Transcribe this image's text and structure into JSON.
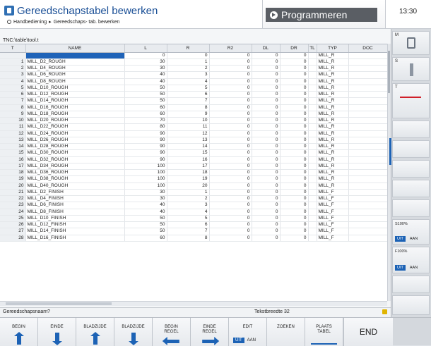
{
  "header": {
    "title": "Gereedschapstabel bewerken",
    "breadcrumb": [
      "Handbediening",
      "Gereedschaps- tab. bewerken"
    ],
    "mode": "Programmeren",
    "clock": "13:30"
  },
  "file_path": "TNC:\\table\\tool.t",
  "table": {
    "columns": [
      "T",
      "NAME",
      "L",
      "R",
      "R2",
      "DL",
      "DR",
      "TL",
      "TYP",
      "DOC"
    ],
    "rows": [
      [
        "",
        "",
        "0",
        "0",
        "0",
        "0",
        "0",
        "",
        "MILL_R",
        ""
      ],
      [
        "1",
        "MILL_D2_ROUGH",
        "30",
        "1",
        "0",
        "0",
        "0",
        "",
        "MILL_R",
        ""
      ],
      [
        "2",
        "MILL_D4_ROUGH",
        "30",
        "2",
        "0",
        "0",
        "0",
        "",
        "MILL_R",
        ""
      ],
      [
        "3",
        "MILL_D6_ROUGH",
        "40",
        "3",
        "0",
        "0",
        "0",
        "",
        "MILL_R",
        ""
      ],
      [
        "4",
        "MILL_D8_ROUGH",
        "40",
        "4",
        "0",
        "0",
        "0",
        "",
        "MILL_R",
        ""
      ],
      [
        "5",
        "MILL_D10_ROUGH",
        "50",
        "5",
        "0",
        "0",
        "0",
        "",
        "MILL_R",
        ""
      ],
      [
        "6",
        "MILL_D12_ROUGH",
        "50",
        "6",
        "0",
        "0",
        "0",
        "",
        "MILL_R",
        ""
      ],
      [
        "7",
        "MILL_D14_ROUGH",
        "50",
        "7",
        "0",
        "0",
        "0",
        "",
        "MILL_R",
        ""
      ],
      [
        "8",
        "MILL_D16_ROUGH",
        "60",
        "8",
        "0",
        "0",
        "0",
        "",
        "MILL_R",
        ""
      ],
      [
        "9",
        "MILL_D18_ROUGH",
        "60",
        "9",
        "0",
        "0",
        "0",
        "",
        "MILL_R",
        ""
      ],
      [
        "10",
        "MILL_D20_ROUGH",
        "70",
        "10",
        "0",
        "0",
        "0",
        "",
        "MILL_R",
        ""
      ],
      [
        "11",
        "MILL_D22_ROUGH",
        "80",
        "11",
        "0",
        "0",
        "0",
        "",
        "MILL_R",
        ""
      ],
      [
        "12",
        "MILL_D24_ROUGH",
        "90",
        "12",
        "0",
        "0",
        "0",
        "",
        "MILL_R",
        ""
      ],
      [
        "13",
        "MILL_D26_ROUGH",
        "90",
        "13",
        "0",
        "0",
        "0",
        "",
        "MILL_R",
        ""
      ],
      [
        "14",
        "MILL_D28_ROUGH",
        "90",
        "14",
        "0",
        "0",
        "0",
        "",
        "MILL_R",
        ""
      ],
      [
        "15",
        "MILL_D30_ROUGH",
        "90",
        "15",
        "0",
        "0",
        "0",
        "",
        "MILL_R",
        ""
      ],
      [
        "16",
        "MILL_D32_ROUGH",
        "90",
        "16",
        "0",
        "0",
        "0",
        "",
        "MILL_R",
        ""
      ],
      [
        "17",
        "MILL_D34_ROUGH",
        "100",
        "17",
        "0",
        "0",
        "0",
        "",
        "MILL_R",
        ""
      ],
      [
        "18",
        "MILL_D36_ROUGH",
        "100",
        "18",
        "0",
        "0",
        "0",
        "",
        "MILL_R",
        ""
      ],
      [
        "19",
        "MILL_D38_ROUGH",
        "100",
        "19",
        "0",
        "0",
        "0",
        "",
        "MILL_R",
        ""
      ],
      [
        "20",
        "MILL_D40_ROUGH",
        "100",
        "20",
        "0",
        "0",
        "0",
        "",
        "MILL_R",
        ""
      ],
      [
        "21",
        "MILL_D2_FINISH",
        "30",
        "1",
        "0",
        "0",
        "0",
        "",
        "MILL_F",
        ""
      ],
      [
        "22",
        "MILL_D4_FINISH",
        "30",
        "2",
        "0",
        "0",
        "0",
        "",
        "MILL_F",
        ""
      ],
      [
        "23",
        "MILL_D6_FINISH",
        "40",
        "3",
        "0",
        "0",
        "0",
        "",
        "MILL_F",
        ""
      ],
      [
        "24",
        "MILL_D8_FINISH",
        "40",
        "4",
        "0",
        "0",
        "0",
        "",
        "MILL_F",
        ""
      ],
      [
        "25",
        "MILL_D10_FINISH",
        "50",
        "5",
        "0",
        "0",
        "0",
        "",
        "MILL_F",
        ""
      ],
      [
        "26",
        "MILL_D12_FINISH",
        "50",
        "6",
        "0",
        "0",
        "0",
        "",
        "MILL_F",
        ""
      ],
      [
        "27",
        "MILL_D14_FINISH",
        "50",
        "7",
        "0",
        "0",
        "0",
        "",
        "MILL_F",
        ""
      ],
      [
        "28",
        "MILL_D16_FINISH",
        "60",
        "8",
        "0",
        "0",
        "0",
        "",
        "MILL_F",
        ""
      ]
    ],
    "selected_row": 0
  },
  "status": {
    "left": "Gereedschapsnaam?",
    "right": "Tekstbreedte 32"
  },
  "softkeys": [
    {
      "label": "BEGIN",
      "arrow": "up"
    },
    {
      "label": "EINDE",
      "arrow": "down"
    },
    {
      "label": "BLADZIJDE",
      "arrow": "up"
    },
    {
      "label": "BLADZIJDE",
      "arrow": "down"
    },
    {
      "label": "BEGIN\nREGEL",
      "arrow": "left"
    },
    {
      "label": "EINDE\nREGEL",
      "arrow": "right"
    },
    {
      "label": "EDIT",
      "arrow": "toggle",
      "off": "UIT",
      "on": "AAN"
    },
    {
      "label": "ZOEKEN",
      "arrow": "none"
    },
    {
      "label": "PLAATS\nTABEL",
      "arrow": "line"
    }
  ],
  "end_key": "END",
  "right_panel": {
    "m_label": "M",
    "s_label": "S",
    "t_label": "T",
    "s_override": {
      "label": "S100%",
      "off": "UIT",
      "on": "AAN"
    },
    "f_override": {
      "label": "F100%",
      "off": "UIT",
      "on": "AAN"
    }
  },
  "colors": {
    "accent": "#1c62b5",
    "title": "#1a4f96",
    "mode_bg": "#5a5e64"
  }
}
